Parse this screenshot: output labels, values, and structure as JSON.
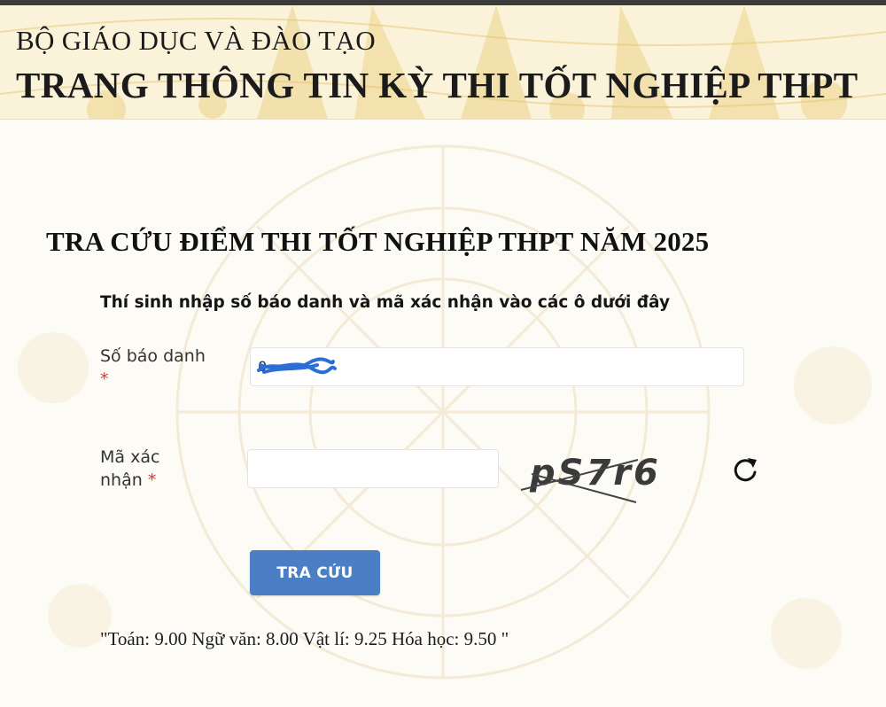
{
  "header": {
    "ministry": "BỘ GIÁO DỤC VÀ ĐÀO TẠO",
    "site_title": "TRANG THÔNG TIN KỲ THI TỐT NGHIỆP THPT"
  },
  "main": {
    "page_title": "TRA CỨU ĐIỂM THI TỐT NGHIỆP THPT NĂM 2025",
    "instruction": "Thí sinh nhập số báo danh và mã xác nhận vào các ô dưới đây",
    "form": {
      "sbd_label": "Số báo danh",
      "required_mark": "*",
      "sbd_value": "0",
      "captcha_label_line1": "Mã xác",
      "captcha_label_line2": "nhận",
      "captcha_value": "",
      "captcha_code": "pS7r6",
      "submit_label": "TRA CỨU"
    },
    "result_text": "\"Toán: 9.00 Ngữ văn: 8.00 Vật lí: 9.25 Hóa học: 9.50 \""
  },
  "colors": {
    "button": "#4a7fc6",
    "required": "#d63a3a",
    "header_bg": "#fbf3d9",
    "redaction": "#2b6fd6"
  },
  "icons": {
    "refresh": "refresh-icon"
  }
}
